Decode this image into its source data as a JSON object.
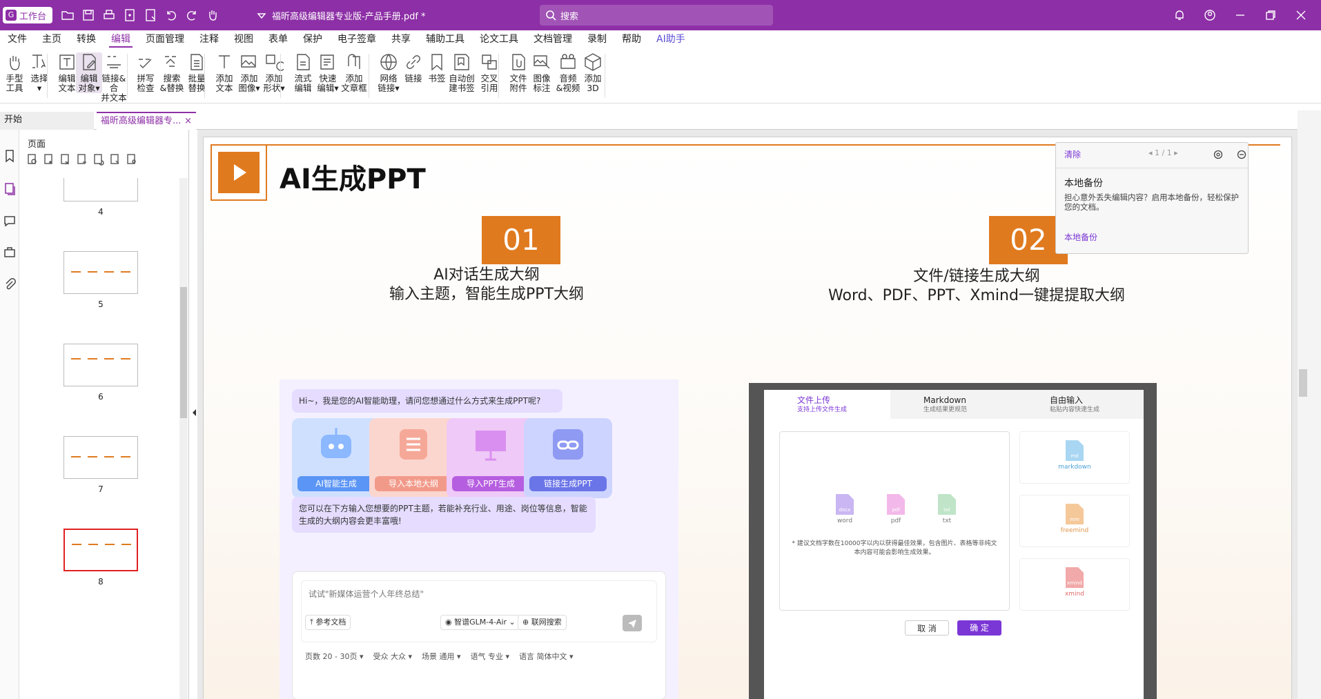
{
  "titlebar": {
    "workbench": "工作台",
    "doc_title": "福昕高级编辑器专业版-产品手册.pdf *",
    "search_placeholder": "搜索"
  },
  "menu": [
    "文件",
    "主页",
    "转换",
    "编辑",
    "页面管理",
    "注释",
    "视图",
    "表单",
    "保护",
    "电子签章",
    "共享",
    "辅助工具",
    "论文工具",
    "文档管理",
    "录制",
    "帮助",
    "AI助手"
  ],
  "menu_active": "编辑",
  "ribbon": [
    {
      "l1": "手型",
      "l2": "工具",
      "icon": "hand-icon"
    },
    {
      "l1": "选择",
      "l2": "▾",
      "icon": "select-icon"
    },
    {
      "l1": "编辑",
      "l2": "文本",
      "icon": "edit-text-icon"
    },
    {
      "l1": "编辑",
      "l2": "对象▾",
      "icon": "edit-object-icon"
    },
    {
      "l1": "链接&合",
      "l2": "并文本",
      "icon": "link-merge-icon"
    },
    {
      "l1": "拼写",
      "l2": "检查",
      "icon": "spell-check-icon"
    },
    {
      "l1": "搜索",
      "l2": "&替换",
      "icon": "search-replace-icon"
    },
    {
      "l1": "批量",
      "l2": "替换",
      "icon": "batch-replace-icon"
    },
    {
      "l1": "添加",
      "l2": "文本",
      "icon": "add-text-icon"
    },
    {
      "l1": "添加",
      "l2": "图像▾",
      "icon": "add-image-icon"
    },
    {
      "l1": "添加",
      "l2": "形状▾",
      "icon": "add-shape-icon"
    },
    {
      "l1": "流式",
      "l2": "编辑",
      "icon": "flow-edit-icon"
    },
    {
      "l1": "快速",
      "l2": "编辑▾",
      "icon": "quick-edit-icon"
    },
    {
      "l1": "添加",
      "l2": "文章框",
      "icon": "article-box-icon"
    },
    {
      "l1": "网络",
      "l2": "链接▾",
      "icon": "web-link-icon"
    },
    {
      "l1": "链接",
      "l2": "",
      "icon": "link-icon"
    },
    {
      "l1": "书签",
      "l2": "",
      "icon": "bookmark-icon"
    },
    {
      "l1": "自动创",
      "l2": "建书签",
      "icon": "auto-bookmark-icon"
    },
    {
      "l1": "交叉",
      "l2": "引用",
      "icon": "cross-ref-icon"
    },
    {
      "l1": "文件",
      "l2": "附件",
      "icon": "file-attach-icon"
    },
    {
      "l1": "图像",
      "l2": "标注",
      "icon": "image-annotate-icon"
    },
    {
      "l1": "音频",
      "l2": "&视频",
      "icon": "av-icon"
    },
    {
      "l1": "添加",
      "l2": "3D",
      "icon": "3d-icon"
    }
  ],
  "tabs": {
    "start": "开始",
    "doc": "福昕高级编辑器专...",
    "close": "×"
  },
  "thumbs": {
    "title": "页面",
    "pages": [
      "4",
      "5",
      "6",
      "7",
      "8"
    ]
  },
  "page": {
    "title": "AI生成PPT",
    "n1": "01",
    "n2": "02",
    "cap1a": "AI对话生成大纲",
    "cap1b": "输入主题，智能生成PPT大纲",
    "cap2a": "文件/链接生成大纲",
    "cap2b": "Word、PDF、PPT、Xmind一键提提取大纲"
  },
  "chat": {
    "greet": "Hi~，我是您的AI智能助理，请问您想通过什么方式来生成PPT呢?",
    "cards": [
      "AI智能生成",
      "导入本地大纲",
      "导入PPT生成",
      "链接生成PPT"
    ],
    "hint": "您可以在下方输入您想要的PPT主题，若能补充行业、用途、岗位等信息，智能生成的大纲内容会更丰富哦!",
    "placeholder": "试试\"新媒体运营个人年终总结\"",
    "ref": "参考文档",
    "model": "智谱GLM-4-Air",
    "web": "联网搜索",
    "opts": [
      "页数  20 - 30页 ▾",
      "受众  大众 ▾",
      "场景  通用 ▾",
      "语气  专业 ▾",
      "语言  简体中文 ▾"
    ]
  },
  "upload": {
    "tabs": [
      {
        "t": "文件上传",
        "s": "支持上传文件生成"
      },
      {
        "t": "Markdown",
        "s": "生成结果更规范"
      },
      {
        "t": "自由输入",
        "s": "粘贴内容快速生成"
      }
    ],
    "files": [
      "word",
      "pdf",
      "txt"
    ],
    "file_tags": [
      "docx",
      "pdf",
      "txt"
    ],
    "note": "* 建议文档字数在10000字以内以获得最佳效果，包含图片、表格等非纯文本内容可能会影响生成效果。",
    "side": [
      "markdown",
      "freemind",
      "xmind"
    ],
    "side_tags": [
      "md",
      "mm",
      "xmind"
    ],
    "cancel": "取 消",
    "ok": "确 定"
  },
  "rightpanel": {
    "clear": "清除",
    "nav": "1 / 1",
    "heading": "本地备份",
    "text": "担心意外丢失编辑内容？启用本地备份，轻松保护您的文档。",
    "link": "本地备份"
  },
  "colors": {
    "accent": "#8d2fa6",
    "orange": "#e07a1f",
    "purple": "#7b36d6"
  }
}
